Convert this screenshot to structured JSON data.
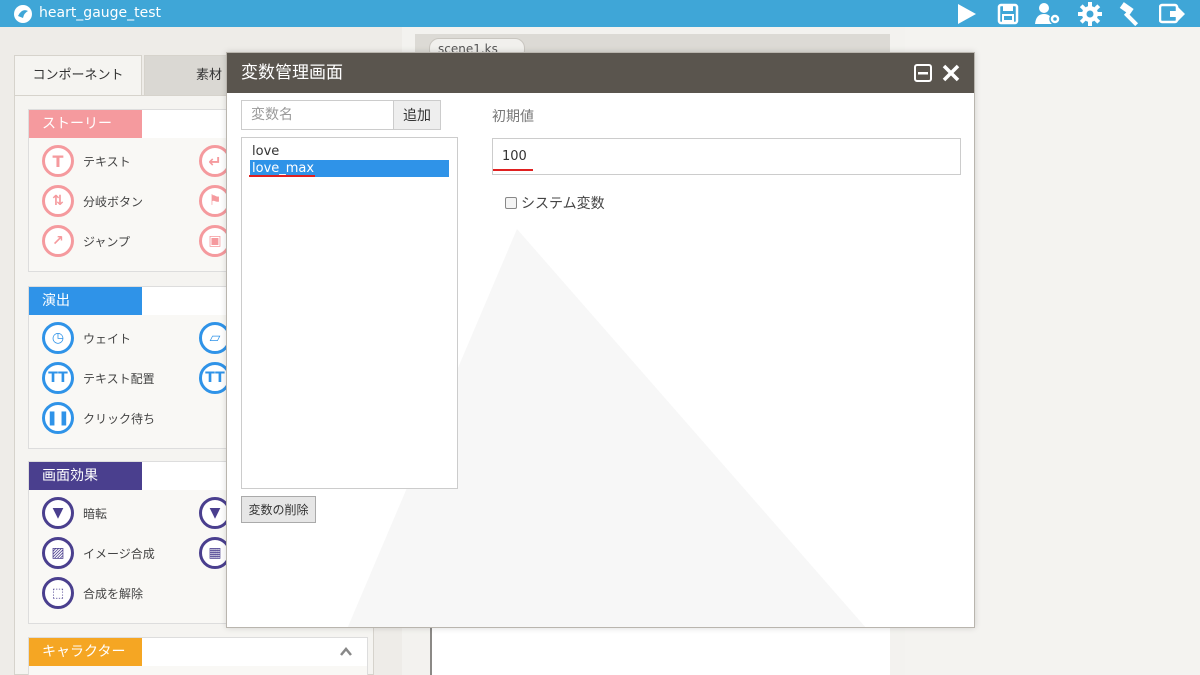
{
  "app": {
    "title": "heart_gauge_test"
  },
  "toolbar": {
    "icons": [
      "play-icon",
      "save-icon",
      "user-settings-icon",
      "gear-icon",
      "hammer-icon",
      "export-icon"
    ]
  },
  "left_panel": {
    "tabs": [
      {
        "label": "コンポーネント",
        "active": true
      },
      {
        "label": "素材",
        "active": false
      }
    ],
    "groups": [
      {
        "label": "ストーリー",
        "color": "#f59a9e",
        "items": [
          "テキスト",
          "分岐ボタン",
          "ジャンプ"
        ]
      },
      {
        "label": "演出",
        "color": "#2f93e8",
        "items": [
          "ウェイト",
          "テキスト配置",
          "クリック待ち"
        ]
      },
      {
        "label": "画面効果",
        "color": "#4a3f8e",
        "items": [
          "暗転",
          "イメージ合成",
          "合成を解除"
        ]
      },
      {
        "label": "キャラクター",
        "color": "#f5a623",
        "items": []
      }
    ]
  },
  "editor": {
    "scene_tab": "scene1.ks"
  },
  "modal": {
    "title": "変数管理画面",
    "var_name_placeholder": "変数名",
    "add_button": "追加",
    "variables": [
      "love",
      "love_max"
    ],
    "selected_variable": "love_max",
    "delete_button": "変数の削除",
    "initial_value_label": "初期値",
    "initial_value": "100",
    "system_variable_label": "システム変数",
    "system_variable_checked": false
  },
  "colors": {
    "topbar": "#3fa6d7",
    "modal_header": "#5a554e",
    "selection": "#2f93e8",
    "annotation_red": "#e02020"
  }
}
